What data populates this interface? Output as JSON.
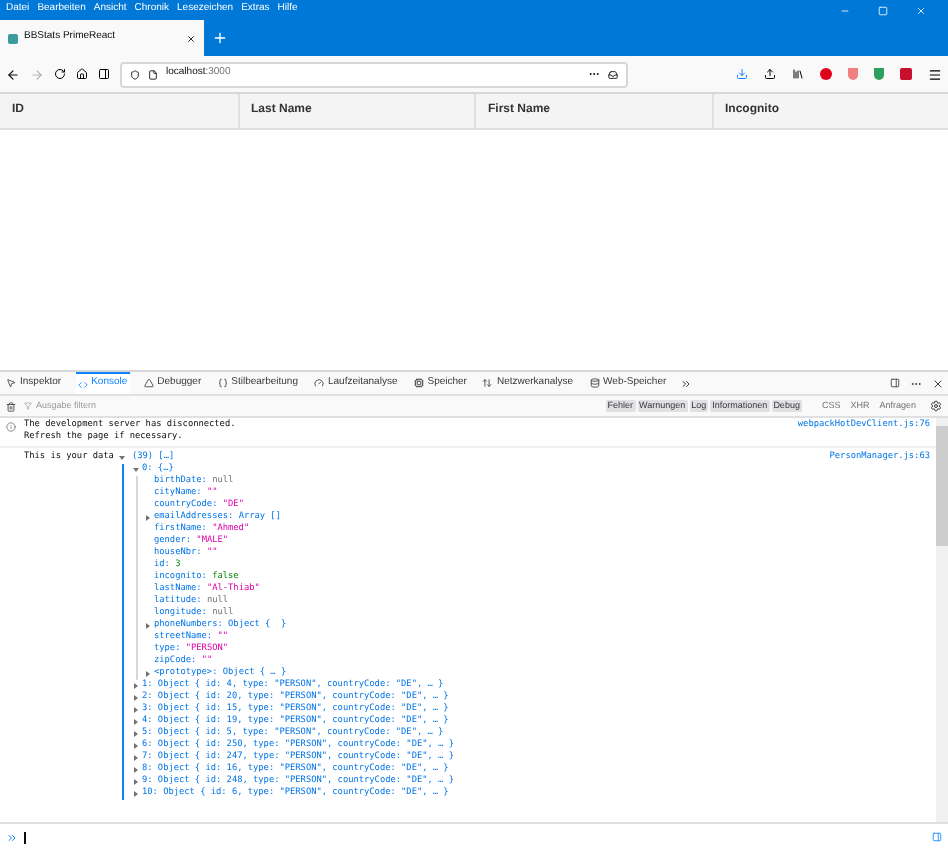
{
  "menu": [
    "Datei",
    "Bearbeiten",
    "Ansicht",
    "Chronik",
    "Lesezeichen",
    "Extras",
    "Hilfe"
  ],
  "tab": {
    "title": "BBStats PrimeReact"
  },
  "url": {
    "host": "localhost",
    "port": ":3000"
  },
  "table": {
    "columns": [
      "ID",
      "Last Name",
      "First Name",
      "Incognito"
    ]
  },
  "devtools": {
    "tabs": [
      {
        "label": "Inspektor",
        "selected": false
      },
      {
        "label": "Konsole",
        "selected": true
      },
      {
        "label": "Debugger",
        "selected": false
      },
      {
        "label": "Stilbearbeitung",
        "selected": false
      },
      {
        "label": "Laufzeitanalyse",
        "selected": false
      },
      {
        "label": "Speicher",
        "selected": false
      },
      {
        "label": "Netzwerkanalyse",
        "selected": false
      },
      {
        "label": "Web-Speicher",
        "selected": false
      }
    ],
    "filter": {
      "placeholder": "Ausgabe filtern"
    },
    "levels": [
      {
        "label": "Fehler",
        "selected": true
      },
      {
        "label": "Warnungen",
        "selected": true
      },
      {
        "label": "Log",
        "selected": true
      },
      {
        "label": "Informationen",
        "selected": true
      },
      {
        "label": "Debug",
        "selected": true
      }
    ],
    "requests": [
      {
        "label": "CSS",
        "selected": false
      },
      {
        "label": "XHR",
        "selected": false
      },
      {
        "label": "Anfragen",
        "selected": false
      }
    ]
  },
  "console": {
    "info": {
      "lines": [
        "The development server has disconnected.",
        "Refresh the page if necessary."
      ],
      "source": "webpackHotDevClient.js:76"
    },
    "log": {
      "text": "This is your data",
      "summary": "(39) […]",
      "source": "PersonManager.js:63",
      "expanded": true,
      "item": {
        "label": "0: {…}",
        "expanded": true,
        "props": [
          {
            "key": "birthDate:",
            "value": "null",
            "kind": "null",
            "expandable": false
          },
          {
            "key": "cityName:",
            "value": "\"\"",
            "kind": "string",
            "expandable": false
          },
          {
            "key": "countryCode:",
            "value": "\"DE\"",
            "kind": "string",
            "expandable": false
          },
          {
            "key": "emailAddresses:",
            "value": "Array []",
            "kind": "object",
            "expandable": true
          },
          {
            "key": "firstName:",
            "value": "\"Ahmed\"",
            "kind": "string",
            "expandable": false
          },
          {
            "key": "gender:",
            "value": "\"MALE\"",
            "kind": "string",
            "expandable": false
          },
          {
            "key": "houseNbr:",
            "value": "\"\"",
            "kind": "string",
            "expandable": false
          },
          {
            "key": "id:",
            "value": "3",
            "kind": "number",
            "expandable": false
          },
          {
            "key": "incognito:",
            "value": "false",
            "kind": "bool",
            "expandable": false
          },
          {
            "key": "lastName:",
            "value": "\"Al-Thiab\"",
            "kind": "string",
            "expandable": false
          },
          {
            "key": "latitude:",
            "value": "null",
            "kind": "null",
            "expandable": false
          },
          {
            "key": "longitude:",
            "value": "null",
            "kind": "null",
            "expandable": false
          },
          {
            "key": "phoneNumbers:",
            "value": "Object {  }",
            "kind": "object",
            "expandable": true
          },
          {
            "key": "streetName:",
            "value": "\"\"",
            "kind": "string",
            "expandable": false
          },
          {
            "key": "type:",
            "value": "\"PERSON\"",
            "kind": "string",
            "expandable": false
          },
          {
            "key": "zipCode:",
            "value": "\"\"",
            "kind": "string",
            "expandable": false
          },
          {
            "key": "<prototype>:",
            "value": "Object { … }",
            "kind": "object",
            "expandable": true
          }
        ]
      },
      "rows": [
        "1: Object { id: 4, type: \"PERSON\", countryCode: \"DE\", … }",
        "2: Object { id: 20, type: \"PERSON\", countryCode: \"DE\", … }",
        "3: Object { id: 15, type: \"PERSON\", countryCode: \"DE\", … }",
        "4: Object { id: 19, type: \"PERSON\", countryCode: \"DE\", … }",
        "5: Object { id: 5, type: \"PERSON\", countryCode: \"DE\", … }",
        "6: Object { id: 250, type: \"PERSON\", countryCode: \"DE\", … }",
        "7: Object { id: 247, type: \"PERSON\", countryCode: \"DE\", … }",
        "8: Object { id: 16, type: \"PERSON\", countryCode: \"DE\", … }",
        "9: Object { id: 248, type: \"PERSON\", countryCode: \"DE\", … }",
        "10: Object { id: 6, type: \"PERSON\", countryCode: \"DE\", … }"
      ]
    }
  }
}
